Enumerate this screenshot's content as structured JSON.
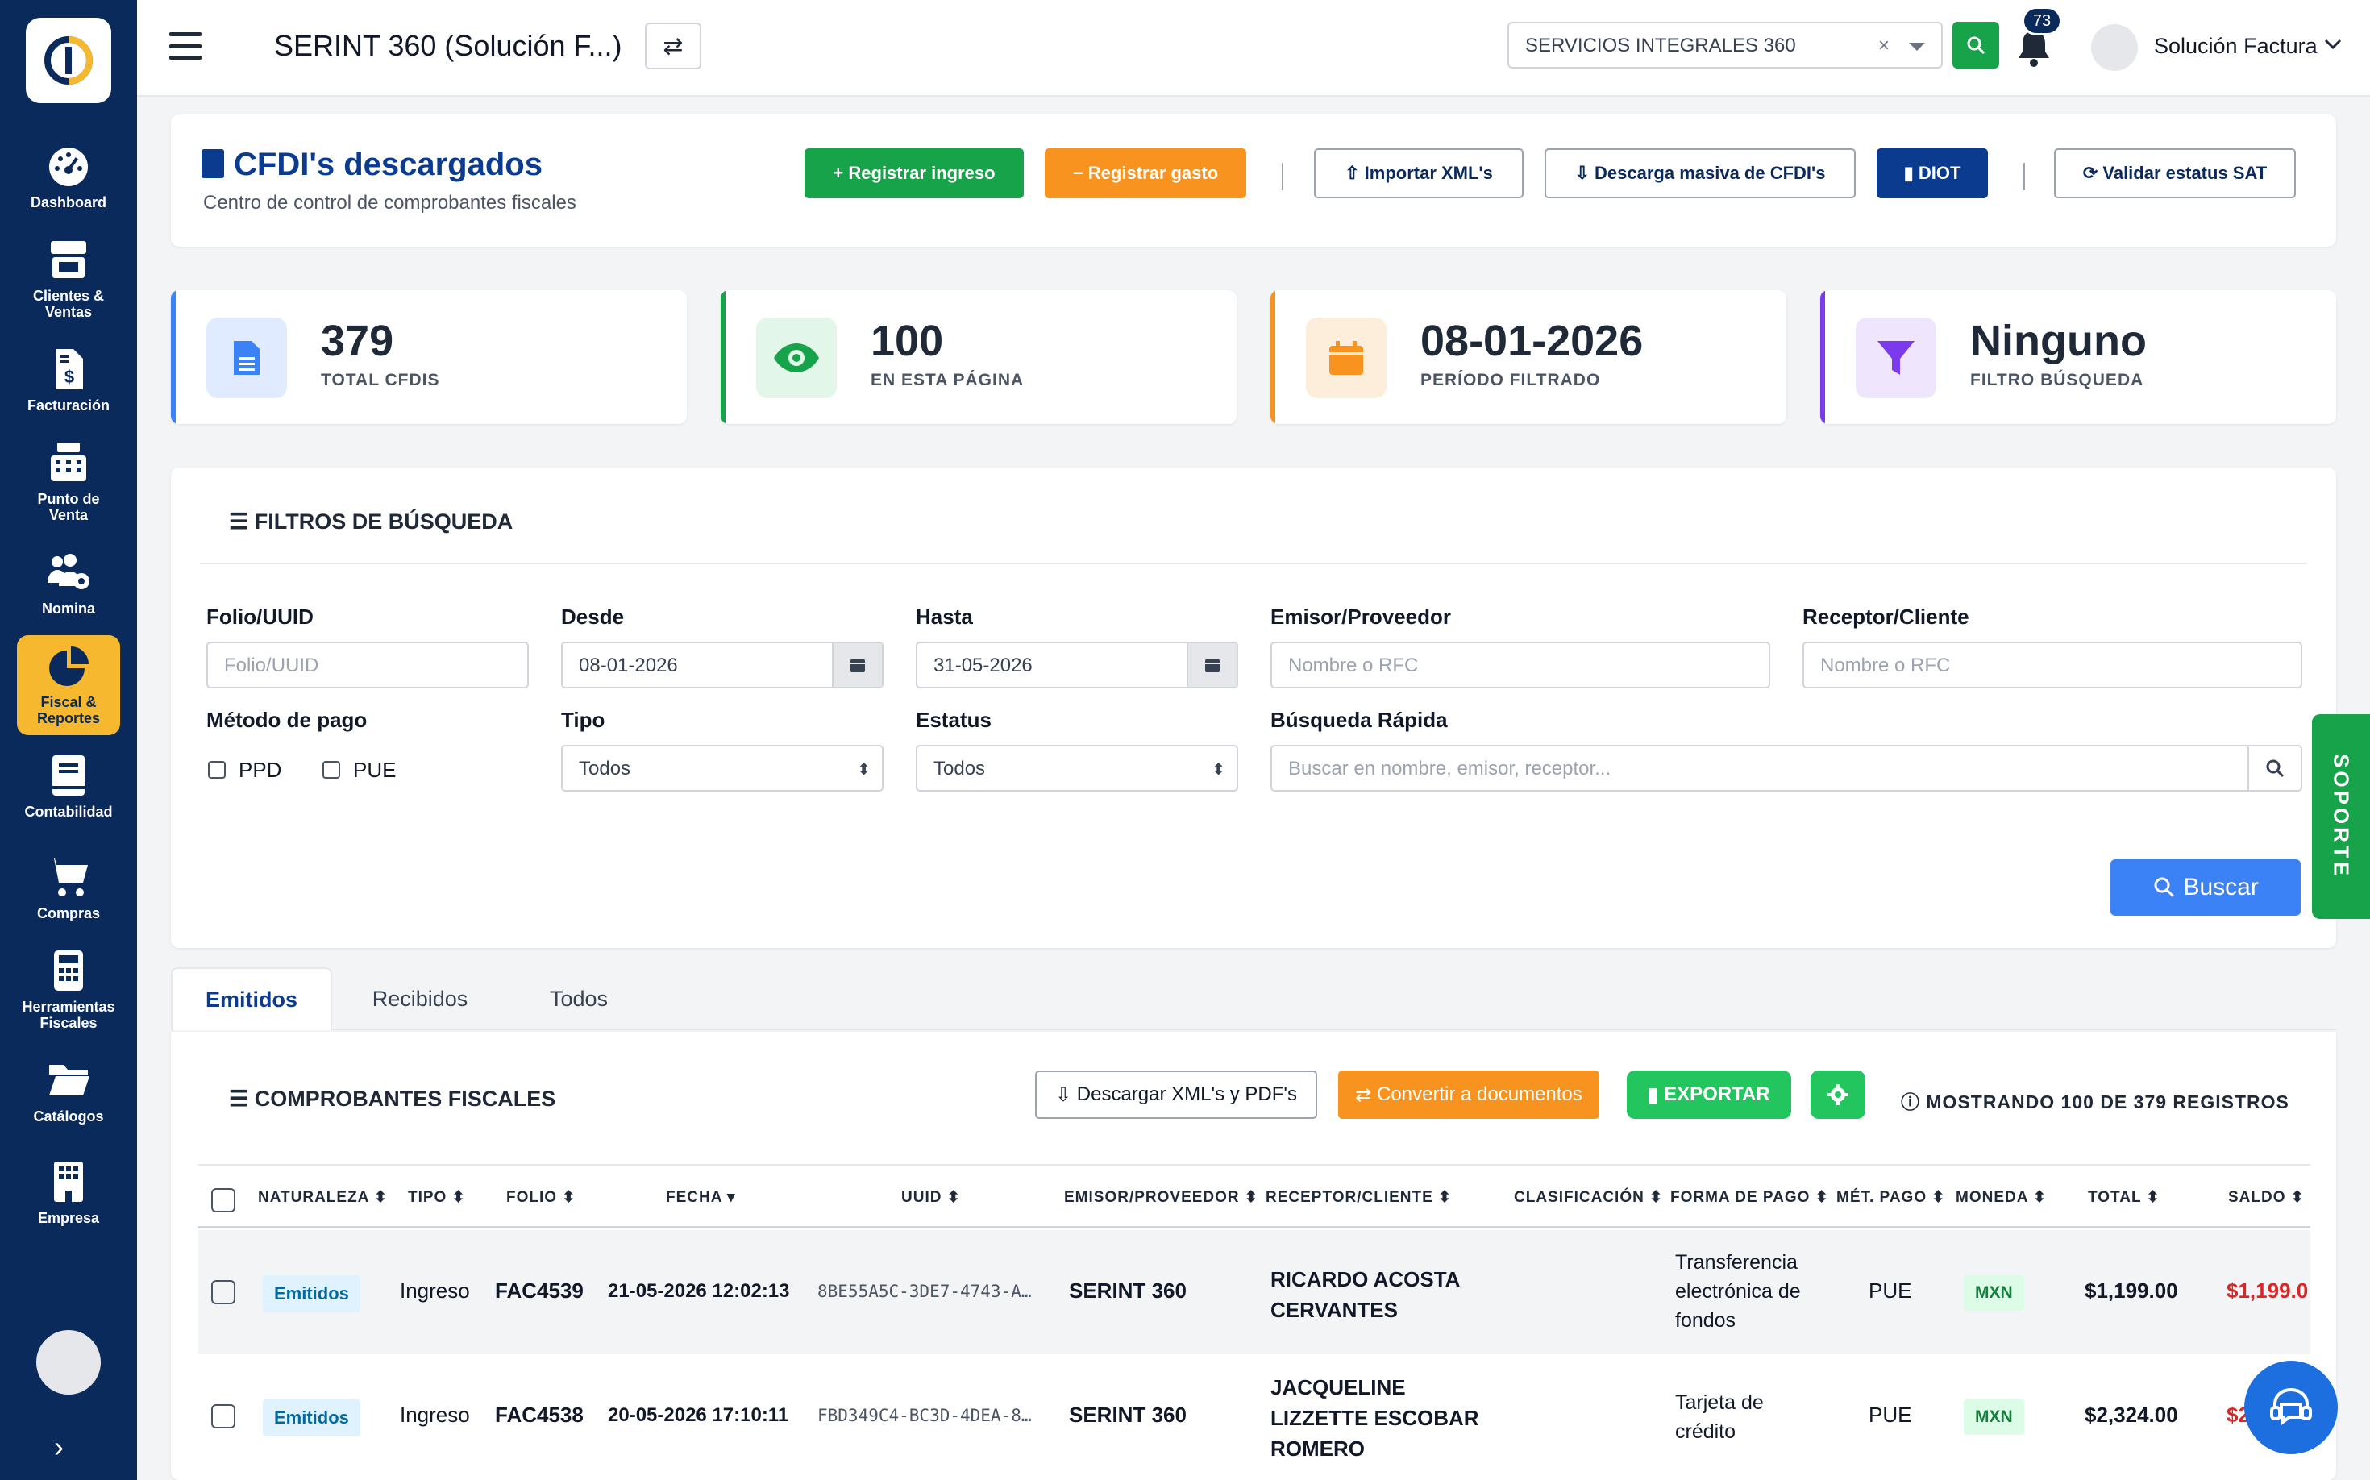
{
  "sidebar": {
    "items": [
      {
        "label": "Dashboard",
        "icon": "gauge-icon"
      },
      {
        "label": "Clientes & Ventas",
        "icon": "store-icon"
      },
      {
        "label": "Facturación",
        "icon": "invoice-dollar-icon"
      },
      {
        "label": "Punto de Venta",
        "icon": "cash-register-icon"
      },
      {
        "label": "Nomina",
        "icon": "users-gear-icon"
      },
      {
        "label": "Fiscal & Reportes",
        "icon": "pie-chart-icon",
        "active": true
      },
      {
        "label": "Contabilidad",
        "icon": "book-icon"
      },
      {
        "label": "Compras",
        "icon": "cart-icon"
      },
      {
        "label": "Herramientas Fiscales",
        "icon": "calculator-icon"
      },
      {
        "label": "Catálogos",
        "icon": "folder-icon"
      },
      {
        "label": "Empresa",
        "icon": "building-icon"
      }
    ],
    "toggle": "›"
  },
  "topbar": {
    "title": "SERINT 360 (Solución F...)",
    "swap_icon": "⇄",
    "company_select": "SERVICIOS INTEGRALES 360",
    "clear": "×",
    "notifications": "73",
    "user": "Solución Factura"
  },
  "header": {
    "title": "CFDI's descargados",
    "subtitle": "Centro de control de comprobantes fiscales",
    "buttons": {
      "ingreso": "+ Registrar ingreso",
      "gasto": "− Registrar gasto",
      "importar": "Importar XML's",
      "descarga": "Descarga masiva de CFDI's",
      "diot": "DIOT",
      "validar": "Validar estatus SAT"
    }
  },
  "stats": [
    {
      "value": "379",
      "label": "TOTAL CFDIS",
      "color": "#3b82f6"
    },
    {
      "value": "100",
      "label": "EN ESTA PÁGINA",
      "color": "#16a34a"
    },
    {
      "value": "08-01-2026",
      "label": "PERÍODO FILTRADO",
      "color": "#f7931e"
    },
    {
      "value": "Ninguno",
      "label": "FILTRO BÚSQUEDA",
      "color": "#7c3aed"
    }
  ],
  "filters": {
    "title": "FILTROS DE BÚSQUEDA",
    "folio_label": "Folio/UUID",
    "folio_placeholder": "Folio/UUID",
    "desde_label": "Desde",
    "desde_value": "08-01-2026",
    "hasta_label": "Hasta",
    "hasta_value": "31-05-2026",
    "emisor_label": "Emisor/Proveedor",
    "emisor_placeholder": "Nombre o RFC",
    "receptor_label": "Receptor/Cliente",
    "receptor_placeholder": "Nombre o RFC",
    "metodo_label": "Método de pago",
    "ppd": "PPD",
    "pue": "PUE",
    "tipo_label": "Tipo",
    "tipo_value": "Todos",
    "estatus_label": "Estatus",
    "estatus_value": "Todos",
    "quick_label": "Búsqueda Rápida",
    "quick_placeholder": "Buscar en nombre, emisor, receptor...",
    "buscar": "Buscar"
  },
  "soporte": "SOPORTE",
  "tabs": [
    "Emitidos",
    "Recibidos",
    "Todos"
  ],
  "table": {
    "title": "COMPROBANTES FISCALES",
    "btn_descargar": "Descargar XML's y PDF's",
    "btn_convertir": "Convertir a documentos",
    "btn_exportar": "EXPORTAR",
    "showing": "MOSTRANDO 100 DE 379 REGISTROS",
    "headers": {
      "naturaleza": "NATURALEZA ⬍",
      "tipo": "TIPO ⬍",
      "folio": "FOLIO ⬍",
      "fecha": "FECHA ▾",
      "uuid": "UUID ⬍",
      "emisor": "EMISOR/PROVEEDOR ⬍",
      "receptor": "RECEPTOR/CLIENTE ⬍",
      "clasificacion": "CLASIFICACIÓN ⬍",
      "forma": "FORMA DE PAGO ⬍",
      "metodo": "MÉT. PAGO ⬍",
      "moneda": "MONEDA ⬍",
      "total": "TOTAL ⬍",
      "saldo": "SALDO ⬍"
    },
    "rows": [
      {
        "naturaleza": "Emitidos",
        "tipo": "Ingreso",
        "folio": "FAC4539",
        "fecha": "21-05-2026 12:02:13",
        "uuid": "8BE55A5C-3DE7-4743-A…",
        "emisor": "SERINT 360",
        "receptor_1": "RICARDO ACOSTA",
        "receptor_2": "CERVANTES",
        "receptor_3": "",
        "forma_1": "Transferencia",
        "forma_2": "electrónica de",
        "forma_3": "fondos",
        "metodo": "PUE",
        "moneda": "MXN",
        "total": "$1,199.00",
        "saldo": "$1,199.0"
      },
      {
        "naturaleza": "Emitidos",
        "tipo": "Ingreso",
        "folio": "FAC4538",
        "fecha": "20-05-2026 17:10:11",
        "uuid": "FBD349C4-BC3D-4DEA-8…",
        "emisor": "SERINT 360",
        "receptor_1": "JACQUELINE",
        "receptor_2": "LIZZETTE ESCOBAR",
        "receptor_3": "ROMERO",
        "forma_1": "Tarjeta de",
        "forma_2": "crédito",
        "forma_3": "",
        "metodo": "PUE",
        "moneda": "MXN",
        "total": "$2,324.00",
        "saldo": "$2"
      }
    ]
  }
}
